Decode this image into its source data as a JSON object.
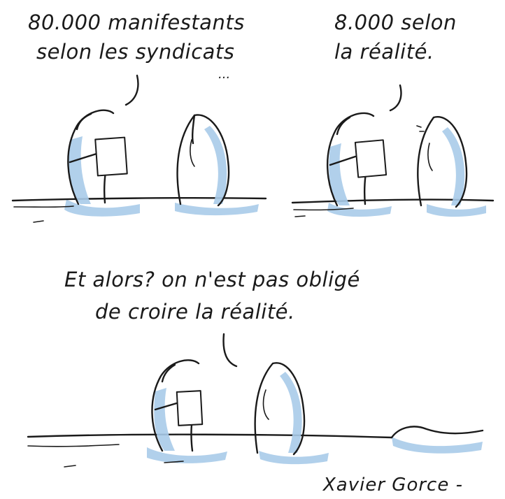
{
  "panels": [
    {
      "speech": [
        "80.000 manifestants",
        "selon les syndicats"
      ],
      "trailing_dots": "..."
    },
    {
      "speech": [
        "8.000 selon",
        "la réalité."
      ]
    },
    {
      "speech": [
        "Et alors? on n'est pas obligé",
        "de croire la réalité."
      ]
    }
  ],
  "signature": "Xavier Gorce -",
  "colors": {
    "ink": "#1a1a1a",
    "wash": "#a9cbe9",
    "background": "#ffffff"
  }
}
